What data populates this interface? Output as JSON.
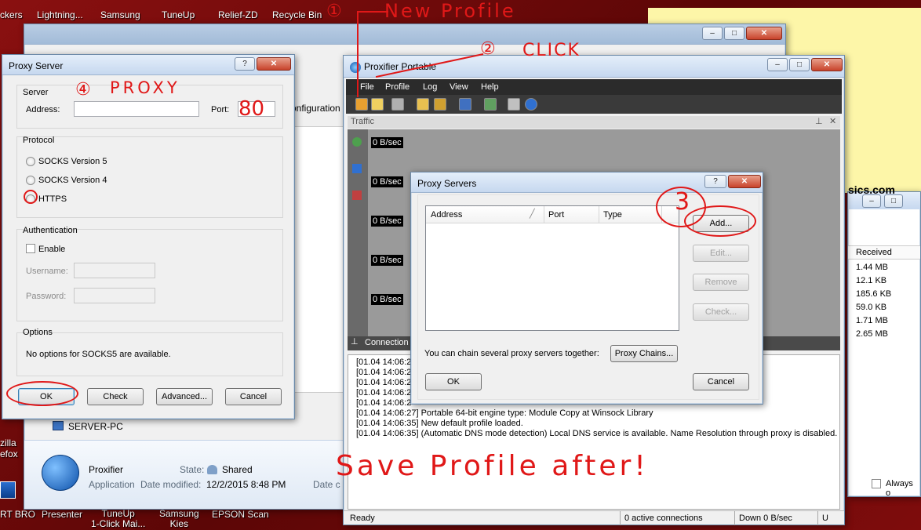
{
  "desktop": {
    "top_icons": [
      "ckers",
      "Lightning...",
      "Samsung",
      "TuneUp",
      "Relief-ZD",
      "Recycle Bin"
    ],
    "bottom_icons": [
      "RT BRO",
      "Presenter",
      "TuneUp\n1-Click Mai...",
      "Samsung\nKies",
      "EPSON Scan"
    ],
    "left_icons": [
      "zilla",
      "efox"
    ]
  },
  "annotations": {
    "a1": "①",
    "a1_text": "New Profile",
    "a2": "②",
    "a2_text": "CLICK",
    "a3": "3",
    "a4": "④",
    "a4_text": "PROXY",
    "port_note": "80",
    "save_note": "Save Profile after!"
  },
  "explorer": {
    "breadcrumb_frag": "onfiguration",
    "server_item": "SERVER-PC",
    "file_name": "Proxifier",
    "file_type": "Application",
    "state_label": "State:",
    "state_value": "Shared",
    "modified_label": "Date modified:",
    "modified_value": "12/2/2015 8:48 PM",
    "date_frag": "Date c"
  },
  "proxy_server_dialog": {
    "title": "Proxy Server",
    "help": "?",
    "close": "✕",
    "server_group": "Server",
    "address_label": "Address:",
    "address_value": "",
    "port_label": "Port:",
    "port_value": "",
    "protocol_group": "Protocol",
    "protocols": [
      "SOCKS Version 5",
      "SOCKS Version 4",
      "HTTPS"
    ],
    "auth_group": "Authentication",
    "enable_label": "Enable",
    "username_label": "Username:",
    "password_label": "Password:",
    "options_group": "Options",
    "options_text": "No options for SOCKS5 are available.",
    "ok": "OK",
    "check": "Check",
    "advanced": "Advanced...",
    "cancel": "Cancel"
  },
  "proxifier": {
    "title": "Proxifier Portable",
    "menu": [
      "File",
      "Profile",
      "Log",
      "View",
      "Help"
    ],
    "traffic_title": "Traffic",
    "traffic_rows": [
      "0 B/sec",
      "0 B/sec",
      "0 B/sec",
      "0 B/sec",
      "0 B/sec"
    ],
    "connections_title": "Connection",
    "log": [
      "[01.04 14:06:2",
      "[01.04 14:06:2",
      "[01.04 14:06:2",
      "[01.04 14:06:2",
      "[01.04 14:06:2",
      "[01.04 14:06:27] Portable 64-bit engine type: Module Copy at Winsock Library",
      "[01.04 14:06:35] New default profile loaded.",
      "[01.04 14:06:35] (Automatic DNS mode detection) Local DNS service is available. Name Resolution through proxy is disabled."
    ],
    "status_ready": "Ready",
    "status_connections": "0 active connections",
    "status_down": "Down 0 B/sec",
    "status_frag": "U"
  },
  "proxy_servers_dialog": {
    "title": "Proxy Servers",
    "help": "?",
    "close": "✕",
    "columns": [
      "Address",
      "Port",
      "Type"
    ],
    "add": "Add...",
    "edit": "Edit...",
    "remove": "Remove",
    "check": "Check...",
    "chain_text": "You can chain several proxy servers together:",
    "chains": "Proxy Chains...",
    "ok": "OK",
    "cancel": "Cancel"
  },
  "right_window": {
    "site_frag": "sics.com",
    "received_header": "Received",
    "received": [
      "1.44 MB",
      "12.1 KB",
      "185.6 KB",
      "59.0 KB",
      "1.71 MB",
      "2.65 MB"
    ],
    "always_label": "Always o"
  },
  "colors": {
    "annotation_red": "#e01818",
    "desktop_red": "#7a0a0a",
    "sticky_yellow": "#fdf6a8"
  }
}
